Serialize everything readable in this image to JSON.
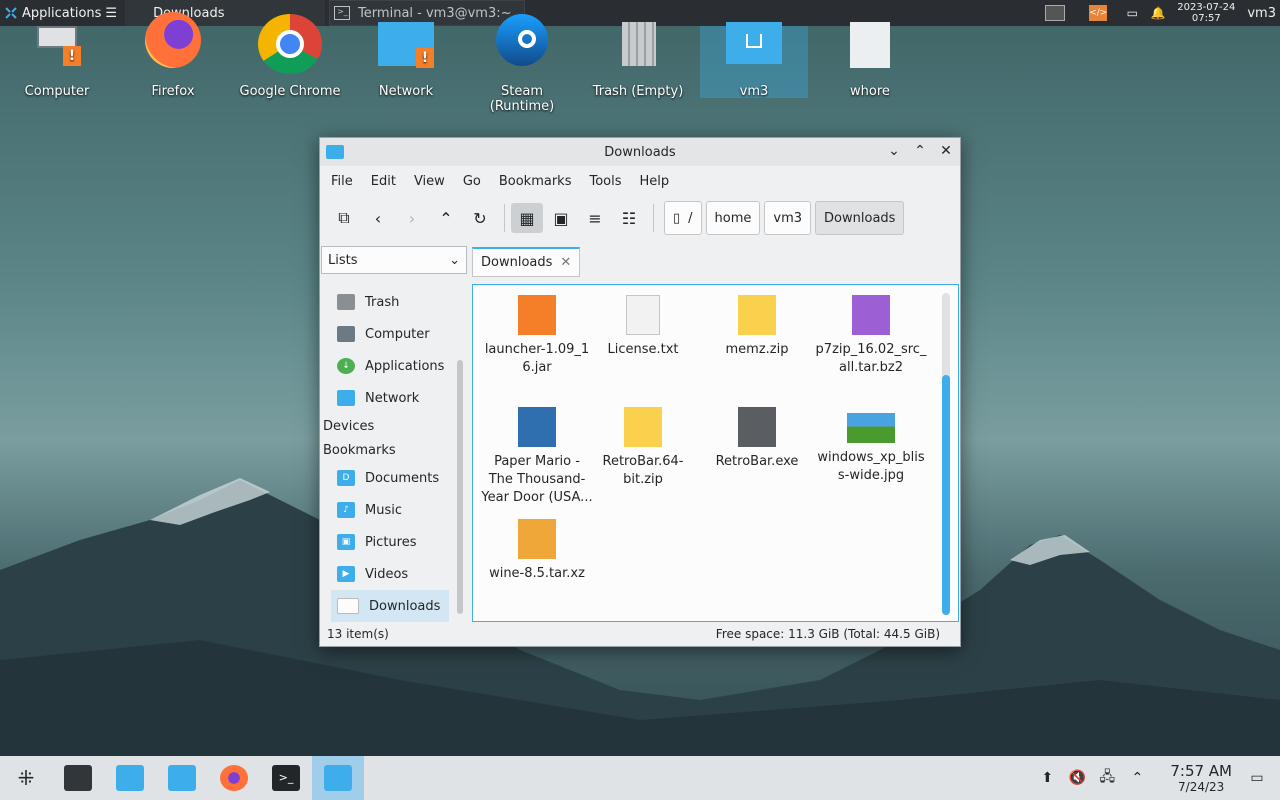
{
  "top_panel": {
    "applications": "Applications",
    "tasks": [
      {
        "label": "Downloads"
      },
      {
        "label": "Terminal - vm3@vm3:~"
      }
    ],
    "clock_date": "2023-07-24",
    "clock_time": "07:57",
    "user": "vm3"
  },
  "desktop_icons": [
    {
      "label": "Computer"
    },
    {
      "label": "Firefox"
    },
    {
      "label": "Google Chrome"
    },
    {
      "label": "Network"
    },
    {
      "label": "Steam (Runtime)"
    },
    {
      "label": "Trash (Empty)"
    },
    {
      "label": "vm3"
    },
    {
      "label": "whore"
    }
  ],
  "window": {
    "title": "Downloads",
    "menu": [
      "File",
      "Edit",
      "View",
      "Go",
      "Bookmarks",
      "Tools",
      "Help"
    ],
    "breadcrumbs": [
      "/",
      "home",
      "vm3",
      "Downloads"
    ],
    "panel_select": "Lists",
    "tab_label": "Downloads",
    "places": [
      {
        "label": "Trash",
        "color": "#8a8f94"
      },
      {
        "label": "Computer",
        "color": "#6c7a84"
      },
      {
        "label": "Applications",
        "color": "#4caf50"
      },
      {
        "label": "Network",
        "color": "#3daee9"
      }
    ],
    "devices_label": "Devices",
    "bookmarks_label": "Bookmarks",
    "bookmarks": [
      {
        "label": "Documents"
      },
      {
        "label": "Music"
      },
      {
        "label": "Pictures"
      },
      {
        "label": "Videos"
      },
      {
        "label": "Downloads"
      }
    ],
    "files": [
      {
        "name": "launcher-1.09_16.jar",
        "line1": "launcher-1.09_1",
        "line2": "6.jar",
        "line3": "",
        "icon": "jar",
        "color": "#f57f29"
      },
      {
        "name": "License.txt",
        "line1": "License.txt",
        "line2": "",
        "line3": "",
        "icon": "text",
        "color": "#f2f2f2"
      },
      {
        "name": "memz.zip",
        "line1": "memz.zip",
        "line2": "",
        "line3": "",
        "icon": "zip",
        "color": "#fad14c"
      },
      {
        "name": "p7zip_16.02_src_all.tar.bz2",
        "line1": "p7zip_16.02_src_",
        "line2": "all.tar.bz2",
        "line3": "",
        "icon": "archive",
        "color": "#9c5fd4"
      },
      {
        "name": "Paper Mario - The Thousand-Year Door (USA...",
        "line1": "Paper Mario -",
        "line2": "The Thousand-",
        "line3": "Year Door (USA...",
        "icon": "archive",
        "color": "#2f6fb0"
      },
      {
        "name": "RetroBar.64-bit.zip",
        "line1": "RetroBar.64-",
        "line2": "bit.zip",
        "line3": "",
        "icon": "zip",
        "color": "#fad14c"
      },
      {
        "name": "RetroBar.exe",
        "line1": "RetroBar.exe",
        "line2": "",
        "line3": "",
        "icon": "exe",
        "color": "#5a5e62"
      },
      {
        "name": "windows_xp_bliss-wide.jpg",
        "line1": "windows_xp_blis",
        "line2": "s-wide.jpg",
        "line3": "",
        "icon": "image",
        "color": "#4a9a2e"
      },
      {
        "name": "wine-8.5.tar.xz",
        "line1": "wine-8.5.tar.xz",
        "line2": "",
        "line3": "",
        "icon": "archive",
        "color": "#f0a73a"
      }
    ],
    "status_count": "13 item(s)",
    "status_free": "Free space: 11.3 GiB (Total: 44.5 GiB)"
  },
  "bottom_panel": {
    "time": "7:57 AM",
    "date": "7/24/23"
  }
}
